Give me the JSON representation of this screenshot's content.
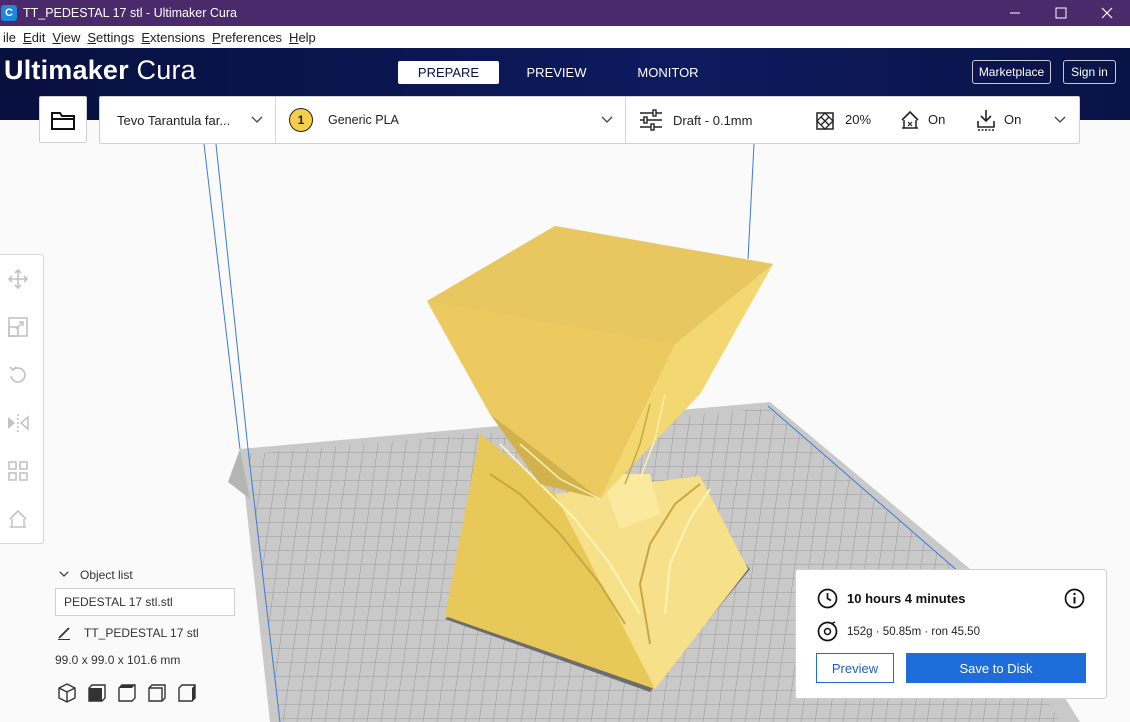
{
  "window": {
    "logo_letter": "C",
    "title": "TT_PEDESTAL 17 stl - Ultimaker Cura",
    "controls": [
      "—",
      "☐",
      "✕"
    ]
  },
  "menubar": [
    {
      "label": "ile",
      "u": "",
      "rest": "ile"
    },
    {
      "label": "Edit",
      "u": "E",
      "rest": "dit"
    },
    {
      "label": "View",
      "u": "V",
      "rest": "iew"
    },
    {
      "label": "Settings",
      "u": "S",
      "rest": "ettings"
    },
    {
      "label": "Extensions",
      "u": "E",
      "rest": "xtensions"
    },
    {
      "label": "Preferences",
      "u": "P",
      "rest": "references"
    },
    {
      "label": "Help",
      "u": "H",
      "rest": "elp"
    }
  ],
  "header": {
    "brand_bold": "Ultimaker",
    "brand_light": " Cura",
    "tabs": [
      {
        "label": "PREPARE",
        "active": true
      },
      {
        "label": "PREVIEW",
        "active": false
      },
      {
        "label": "MONITOR",
        "active": false
      }
    ],
    "marketplace": "Marketplace",
    "signin": "Sign in"
  },
  "toolbar": {
    "printer": "Tevo Tarantula far...",
    "extruder_number": "1",
    "material": "Generic PLA",
    "profile": "Draft - 0.1mm",
    "infill": "20%",
    "support": "On",
    "adhesion": "On"
  },
  "objects": {
    "header": "Object list",
    "field": "PEDESTAL 17 stl.stl",
    "name": "TT_PEDESTAL 17 stl",
    "dims": "99.0 x 99.0 x 101.6 mm"
  },
  "print": {
    "time": "10 hours 4 minutes",
    "material": "152g · 50.85m · ron 45.50",
    "preview": "Preview",
    "save": "Save to Disk"
  },
  "colors": {
    "header": "#0a1146",
    "titlebar": "#4a2a6a",
    "accent": "#1e6ddb",
    "model": "#f2d675",
    "model_dark": "#d8b64a"
  }
}
